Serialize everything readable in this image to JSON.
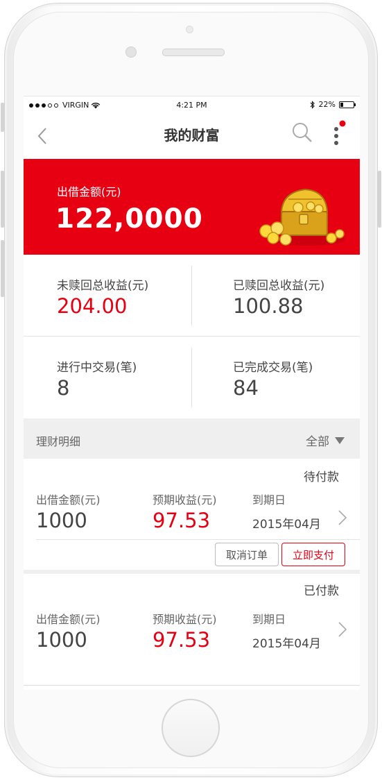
{
  "status_bar": {
    "carrier": "VIRGIN",
    "time": "4:21 PM",
    "battery": "22%",
    "battery_level": 0.22
  },
  "nav": {
    "title": "我的财富",
    "back_icon": "chevron-left-icon",
    "search_icon": "search-icon",
    "more_icon": "more-vertical-icon",
    "has_notification": true
  },
  "summary": {
    "label": "出借金额(元)",
    "value": "122,0000",
    "image": "treasure-chest-icon"
  },
  "stats": [
    {
      "label": "未赎回总收益(元)",
      "value": "204.00",
      "highlight": true
    },
    {
      "label": "已赎回总收益(元)",
      "value": "100.88",
      "highlight": false
    },
    {
      "label": "进行中交易(笔)",
      "value": "8",
      "highlight": false
    },
    {
      "label": "已完成交易(笔)",
      "value": "84",
      "highlight": false
    }
  ],
  "section": {
    "title": "理财明细",
    "filter": "全部"
  },
  "records": [
    {
      "status": "待付款",
      "amount_label": "出借金额(元)",
      "amount": "1000",
      "yield_label": "预期收益(元)",
      "yield": "97.53",
      "due_label": "到期日",
      "due": "2015年04月",
      "cancel_label": "取消订单",
      "pay_label": "立即支付"
    },
    {
      "status": "已付款",
      "amount_label": "出借金额(元)",
      "amount": "1000",
      "yield_label": "预期收益(元)",
      "yield": "97.53",
      "due_label": "到期日",
      "due": "2015年04月"
    }
  ],
  "colors": {
    "accent": "#e60012",
    "text": "#444444",
    "muted": "#666666",
    "section_bg": "#efefef"
  }
}
